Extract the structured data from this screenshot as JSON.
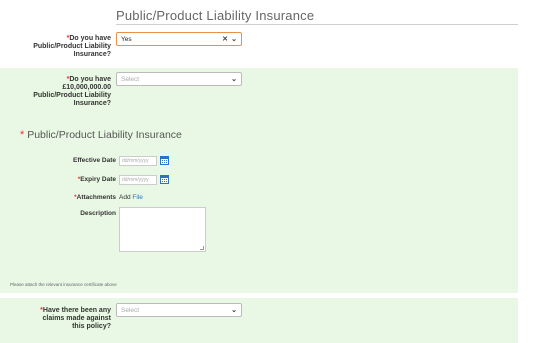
{
  "section": {
    "title": "Public/Product Liability Insurance"
  },
  "q1": {
    "label_line1": "Do you have",
    "label_line2": "Public/Product Liability",
    "label_line3": "Insurance?",
    "value": "Yes",
    "clear_icon": "close-icon",
    "chevron_icon": "chevron-down-icon"
  },
  "q2": {
    "label_line1": "Do you have",
    "label_line2": "£10,000,000.00",
    "label_line3": "Public/Product Liability",
    "label_line4": "Insurance?",
    "placeholder": "Select"
  },
  "subsection": {
    "title": "Public/Product Liability Insurance",
    "effective_label": "Effective Date",
    "effective_placeholder": "dd/mm/yyyy",
    "expiry_label": "Expiry Date",
    "expiry_placeholder": "dd/mm/yyyy",
    "attachments_label": "Attachments",
    "attach_add": "Add",
    "attach_file": "File",
    "description_label": "Description",
    "note": "Please attach the relevant insurance certificate above"
  },
  "q3": {
    "label_line1": "Have there been any",
    "label_line2": "claims made against",
    "label_line3": "this policy?",
    "placeholder": "Select"
  },
  "colors": {
    "band": "#e9f8e4",
    "accent": "#e8914c",
    "required": "#ee3333",
    "link": "#2a73c4"
  },
  "required_mark": "*"
}
